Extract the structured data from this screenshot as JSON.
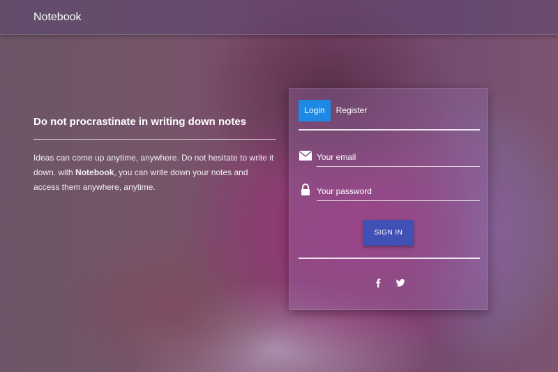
{
  "navbar": {
    "brand": "Notebook"
  },
  "hero": {
    "title": "Do not procrastinate in writing down notes",
    "text_part1": "Ideas can come up anytime, anywhere. Do not hesitate to write it down. with ",
    "text_bold": "Notebook",
    "text_part2": ", you can write down your notes and access them anywhere, anytime."
  },
  "form": {
    "tabs": [
      {
        "label": "Login",
        "active": true
      },
      {
        "label": "Register",
        "active": false
      }
    ],
    "email": {
      "placeholder": "Your email",
      "value": "",
      "icon": "envelope-icon"
    },
    "password": {
      "placeholder": "Your password",
      "value": "",
      "icon": "lock-icon"
    },
    "submit_label": "SIGN IN",
    "social": [
      {
        "icon": "facebook-icon",
        "glyph": "f"
      },
      {
        "icon": "twitter-icon",
        "glyph": ""
      }
    ]
  },
  "colors": {
    "active_tab": "#1e88e5",
    "signin_button": "#3f51b5"
  }
}
